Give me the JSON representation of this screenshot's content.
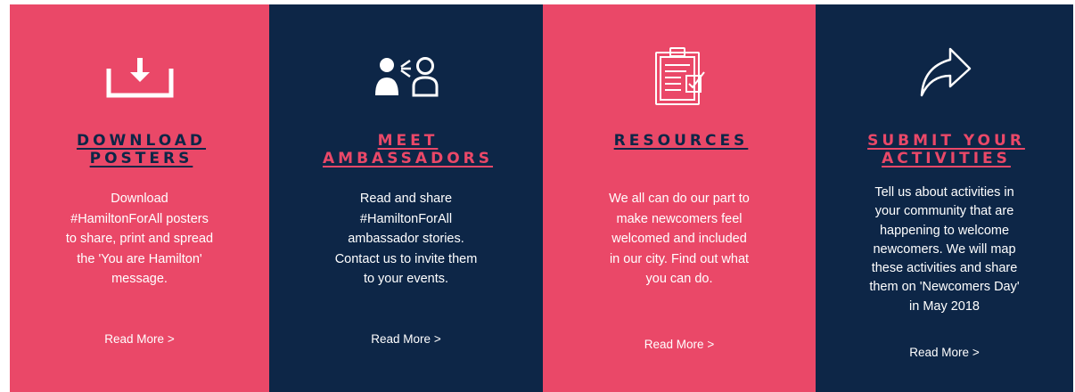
{
  "colors": {
    "pink": "#ea4868",
    "navy": "#0d2647",
    "white": "#ffffff"
  },
  "panels": [
    {
      "icon": "download-icon",
      "title_line1": "DOWNLOAD",
      "title_line2": "POSTERS",
      "description": [
        "Download",
        "#HamiltonForAll posters",
        "to share, print and spread",
        "the 'You are Hamilton'",
        "message."
      ],
      "read_more": "Read More >"
    },
    {
      "icon": "ambassador-icon",
      "title_line1": "MEET",
      "title_line2": "AMBASSADORS",
      "description": [
        "Read and share",
        "#HamiltonForAll",
        "ambassador stories.",
        "Contact us to invite them",
        "to your events."
      ],
      "read_more": "Read More >"
    },
    {
      "icon": "clipboard-icon",
      "title_line1": "RESOURCES",
      "title_line2": "",
      "description": [
        "We all can do our part to",
        "make newcomers feel",
        "welcomed and included",
        "in our city. Find out what",
        "you can do."
      ],
      "read_more": "Read More >"
    },
    {
      "icon": "share-arrow-icon",
      "title_line1": "SUBMIT YOUR",
      "title_line2": "ACTIVITIES",
      "description": [
        "Tell us about activities in",
        "your community that are",
        "happening to welcome",
        "newcomers. We will map",
        "these activities and share",
        "them on 'Newcomers Day'",
        "in May 2018"
      ],
      "read_more": "Read More >"
    }
  ]
}
